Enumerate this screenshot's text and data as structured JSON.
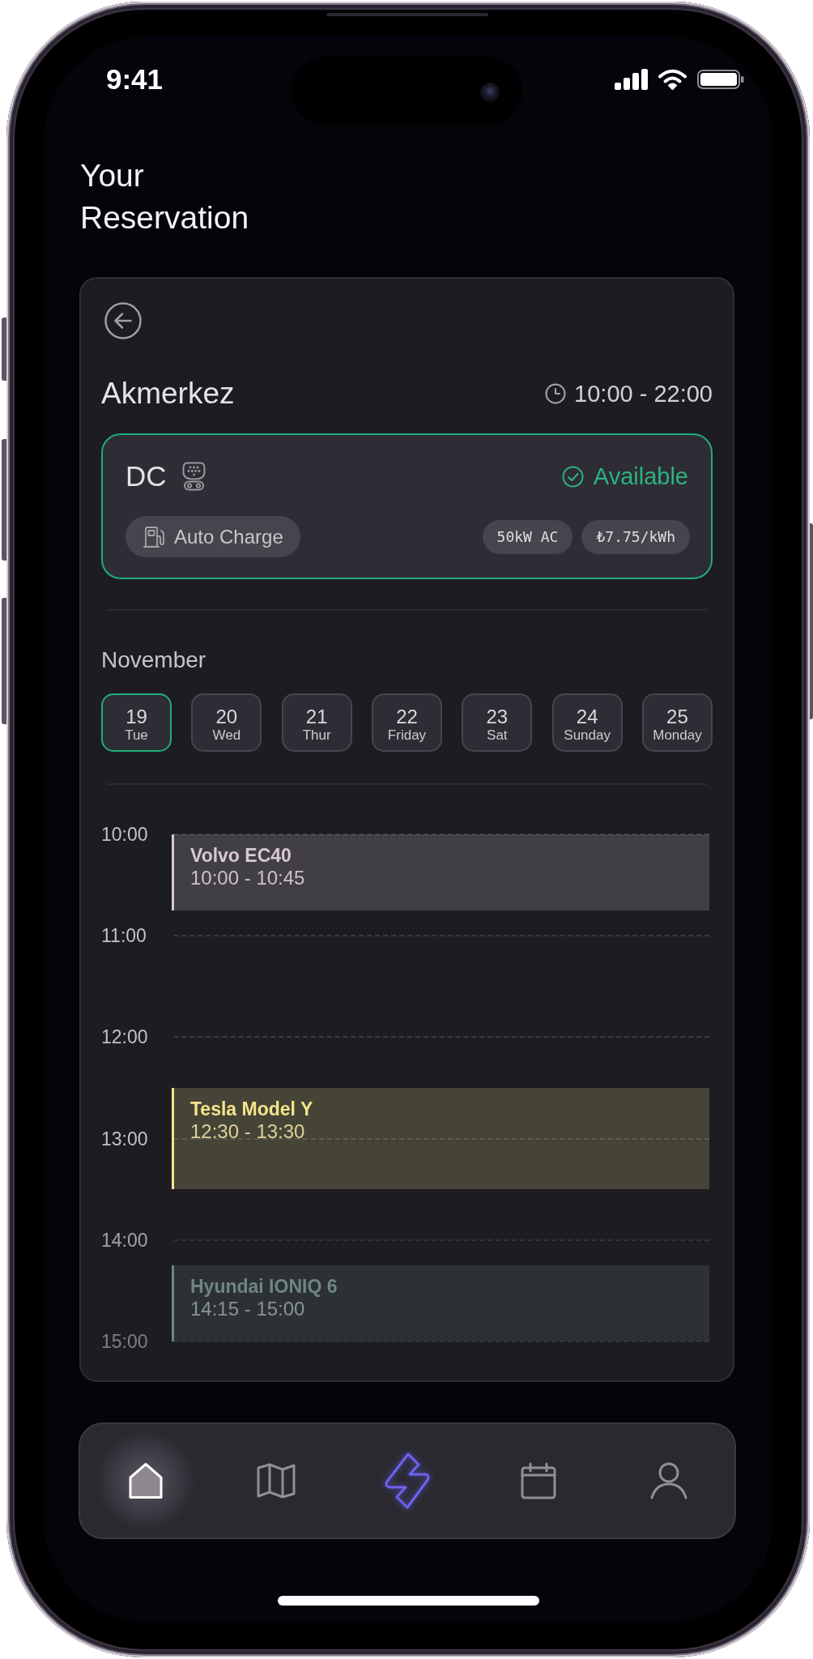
{
  "status_bar": {
    "time": "9:41"
  },
  "heading": {
    "title": "Your Reservation"
  },
  "station": {
    "name": "Akmerkez",
    "hours": "10:00 - 22:00"
  },
  "charger": {
    "type": "DC",
    "available": true,
    "status": "Available",
    "mode": "Auto Charge",
    "specs": [
      "50kW AC",
      "₺7.75/kWh"
    ]
  },
  "calendar": {
    "month": "November",
    "days": [
      {
        "date": "19",
        "weekday": "Tue",
        "selected": true
      },
      {
        "date": "20",
        "weekday": "Wed",
        "selected": false
      },
      {
        "date": "21",
        "weekday": "Thur",
        "selected": false
      },
      {
        "date": "22",
        "weekday": "Friday",
        "selected": false
      },
      {
        "date": "23",
        "weekday": "Sat",
        "selected": false
      },
      {
        "date": "24",
        "weekday": "Sunday",
        "selected": false
      },
      {
        "date": "25",
        "weekday": "Monday",
        "selected": false
      }
    ]
  },
  "timeline": {
    "hours": [
      "10:00",
      "11:00",
      "12:00",
      "13:00",
      "14:00",
      "15:00"
    ],
    "bookings": [
      {
        "vehicle": "Volvo EC40",
        "time": "10:00 - 10:45",
        "color": "#d8c8d4"
      },
      {
        "vehicle": "Tesla Model Y",
        "time": "12:30 - 13:30",
        "color": "#f2e48c"
      },
      {
        "vehicle": "Hyundai IONIQ 6",
        "time": "14:15 - 15:00",
        "color": "#6f8586"
      }
    ]
  },
  "tab_bar": {
    "items": [
      {
        "kind": "tab",
        "selected": true
      },
      {
        "kind": "tab",
        "selected": false
      },
      {
        "kind": "action",
        "selected": false
      },
      {
        "kind": "tab",
        "selected": false
      },
      {
        "kind": "tab",
        "selected": false
      }
    ]
  }
}
